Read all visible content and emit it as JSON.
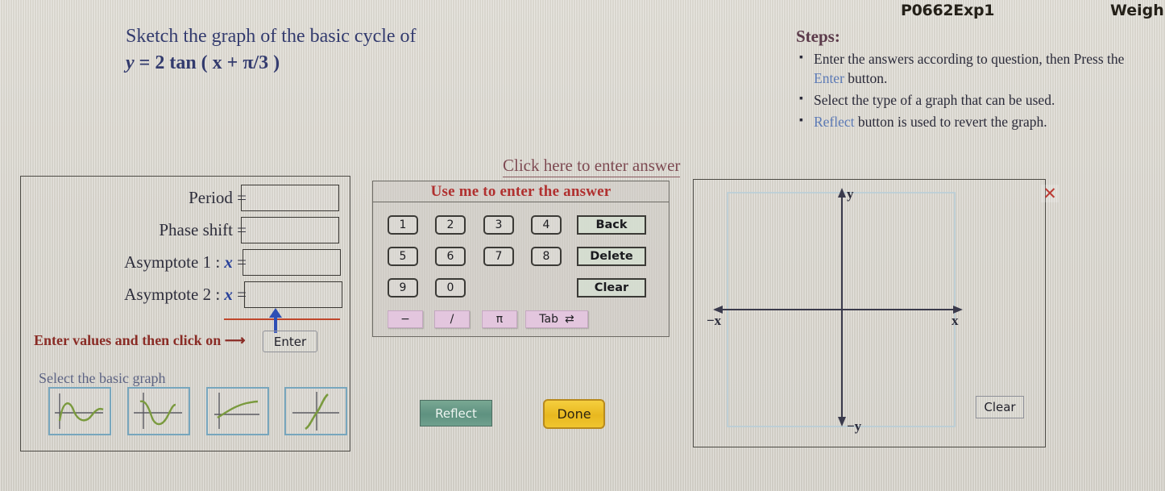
{
  "header": {
    "exercise_id": "P0662Exp1",
    "weight_label": "Weigh"
  },
  "question": {
    "line1": "Sketch the graph of the basic cycle of",
    "equation_y": "y",
    "equation_eq": "=",
    "equation_rest": "2 tan ( x + π/3 )",
    "equation_full": "y = 2 tan ( x + π/3 )"
  },
  "steps": {
    "title": "Steps:",
    "items": [
      {
        "pre": "Enter the answers according to question, then Press the ",
        "kw": "Enter",
        "post": " button."
      },
      {
        "pre": "Select the type of a graph that can be used.",
        "kw": "",
        "post": ""
      },
      {
        "pre": "",
        "kw": "Reflect",
        "post": " button is used to revert the graph."
      }
    ]
  },
  "click_here_link": "Click here to enter answer",
  "answer_panel": {
    "fields": [
      {
        "label": "Period",
        "sep": "=",
        "value": "",
        "has_x": false
      },
      {
        "label": "Phase shift",
        "sep": "=",
        "value": "",
        "has_x": false
      },
      {
        "label": "Asymptote 1 :",
        "sep": "=",
        "value": "",
        "has_x": true,
        "x_sym": "x"
      },
      {
        "label": "Asymptote 2 :",
        "sep": "=",
        "value": "",
        "has_x": true,
        "x_sym": "x"
      }
    ],
    "enter_hint": "Enter values and then click on ⟶",
    "enter_button": "Enter",
    "select_graph_label": "Select the basic graph",
    "thumbnails": [
      {
        "name": "sine-curve"
      },
      {
        "name": "cosine-curve"
      },
      {
        "name": "log-curve"
      },
      {
        "name": "tangent-curve"
      }
    ]
  },
  "keypad": {
    "title": "Use me to enter the answer",
    "rows": [
      {
        "digits": [
          "1",
          "2",
          "3",
          "4"
        ],
        "cmd": "Back"
      },
      {
        "digits": [
          "5",
          "6",
          "7",
          "8"
        ],
        "cmd": "Delete"
      },
      {
        "digits": [
          "9",
          "0"
        ],
        "cmd": "Clear"
      }
    ],
    "ops": [
      "−",
      "/",
      "π"
    ],
    "tab_label": "Tab",
    "tab_glyph": "⇄"
  },
  "actions": {
    "reflect": "Reflect",
    "done": "Done"
  },
  "graph_panel": {
    "close_icon": "✕",
    "clear_button": "Clear",
    "axis_labels": {
      "y_pos": "y",
      "y_neg": "−y",
      "x_pos": "x",
      "x_neg": "−x"
    }
  },
  "colors": {
    "background": "#d8d5cd",
    "question_text": "#333b6e",
    "steps_title": "#5b3a4a",
    "keyword_blue": "#5b79b5",
    "link_maroon": "#7d4a52",
    "keypad_title_red": "#b0302f",
    "hint_red": "#8a2c26",
    "reflect_green": "#5e9180",
    "done_yellow": "#e8b820",
    "op_key_pink": "#e3c6de",
    "thumb_border_blue": "#77a6bd",
    "axis_navy": "#2b2b3a",
    "close_red": "#bb3a33",
    "underline_red": "#c0472c",
    "arrow_blue": "#2f4fb5"
  }
}
